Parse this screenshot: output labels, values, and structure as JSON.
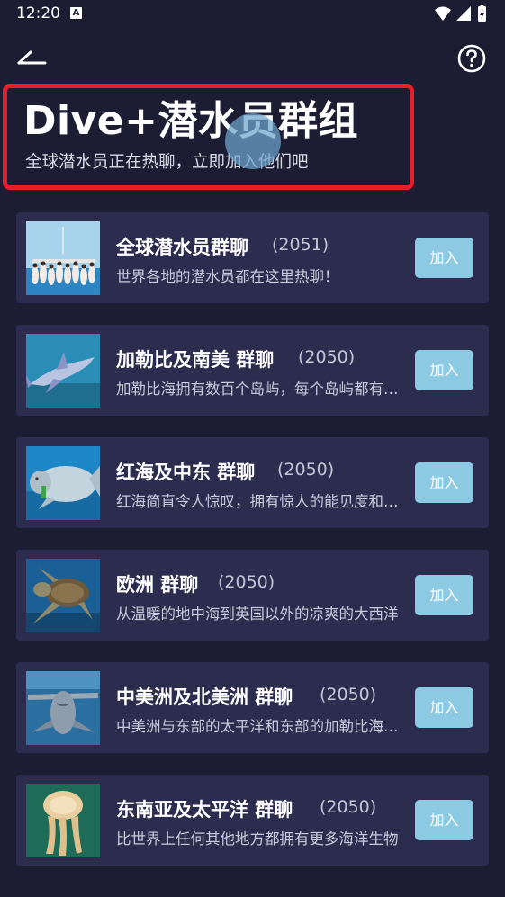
{
  "status_bar": {
    "time": "12:20",
    "notification_letter": "A",
    "icons": [
      "wifi-icon",
      "signal-icon",
      "battery-icon"
    ]
  },
  "topbar": {
    "back_icon": "back-arrow-icon",
    "help_icon": "help-icon"
  },
  "header": {
    "title": "Dive+潜水员群组",
    "subtitle": "全球潜水员正在热聊，立即加入他们吧"
  },
  "groups": [
    {
      "title": "全球潜水员群聊",
      "count": "(2051)",
      "description": "世界各地的潜水员都在这里热聊！",
      "join_label": "加入",
      "thumb": "divers-group-photo"
    },
    {
      "title": "加勒比及南美 群聊",
      "count": "(2050)",
      "description": "加勒比海拥有数百个岛屿，每个岛屿都有其独特的魅力",
      "join_label": "加入",
      "thumb": "shark-photo"
    },
    {
      "title": "红海及中东 群聊",
      "count": "(2050)",
      "description": "红海简直令人惊叹，拥有惊人的能见度和丰富的海洋生物",
      "join_label": "加入",
      "thumb": "dugong-photo"
    },
    {
      "title": "欧洲  群聊",
      "count": "(2050)",
      "description": "从温暖的地中海到英国以外的凉爽的大西洋",
      "join_label": "加入",
      "thumb": "sea-turtle-photo"
    },
    {
      "title": "中美洲及北美洲 群聊",
      "count": "(2050)",
      "description": "中美洲与东部的太平洋和东部的加勒比海相邻",
      "join_label": "加入",
      "thumb": "hammerhead-shark-photo"
    },
    {
      "title": "东南亚及太平洋 群聊",
      "count": "(2050)",
      "description": "比世界上任何其他地方都拥有更多海洋生物",
      "join_label": "加入",
      "thumb": "jellyfish-photo"
    }
  ],
  "colors": {
    "background": "#1c1d33",
    "card": "#2c2d4e",
    "join_button": "#8cc9e3",
    "highlight_box": "#e51e2b"
  }
}
